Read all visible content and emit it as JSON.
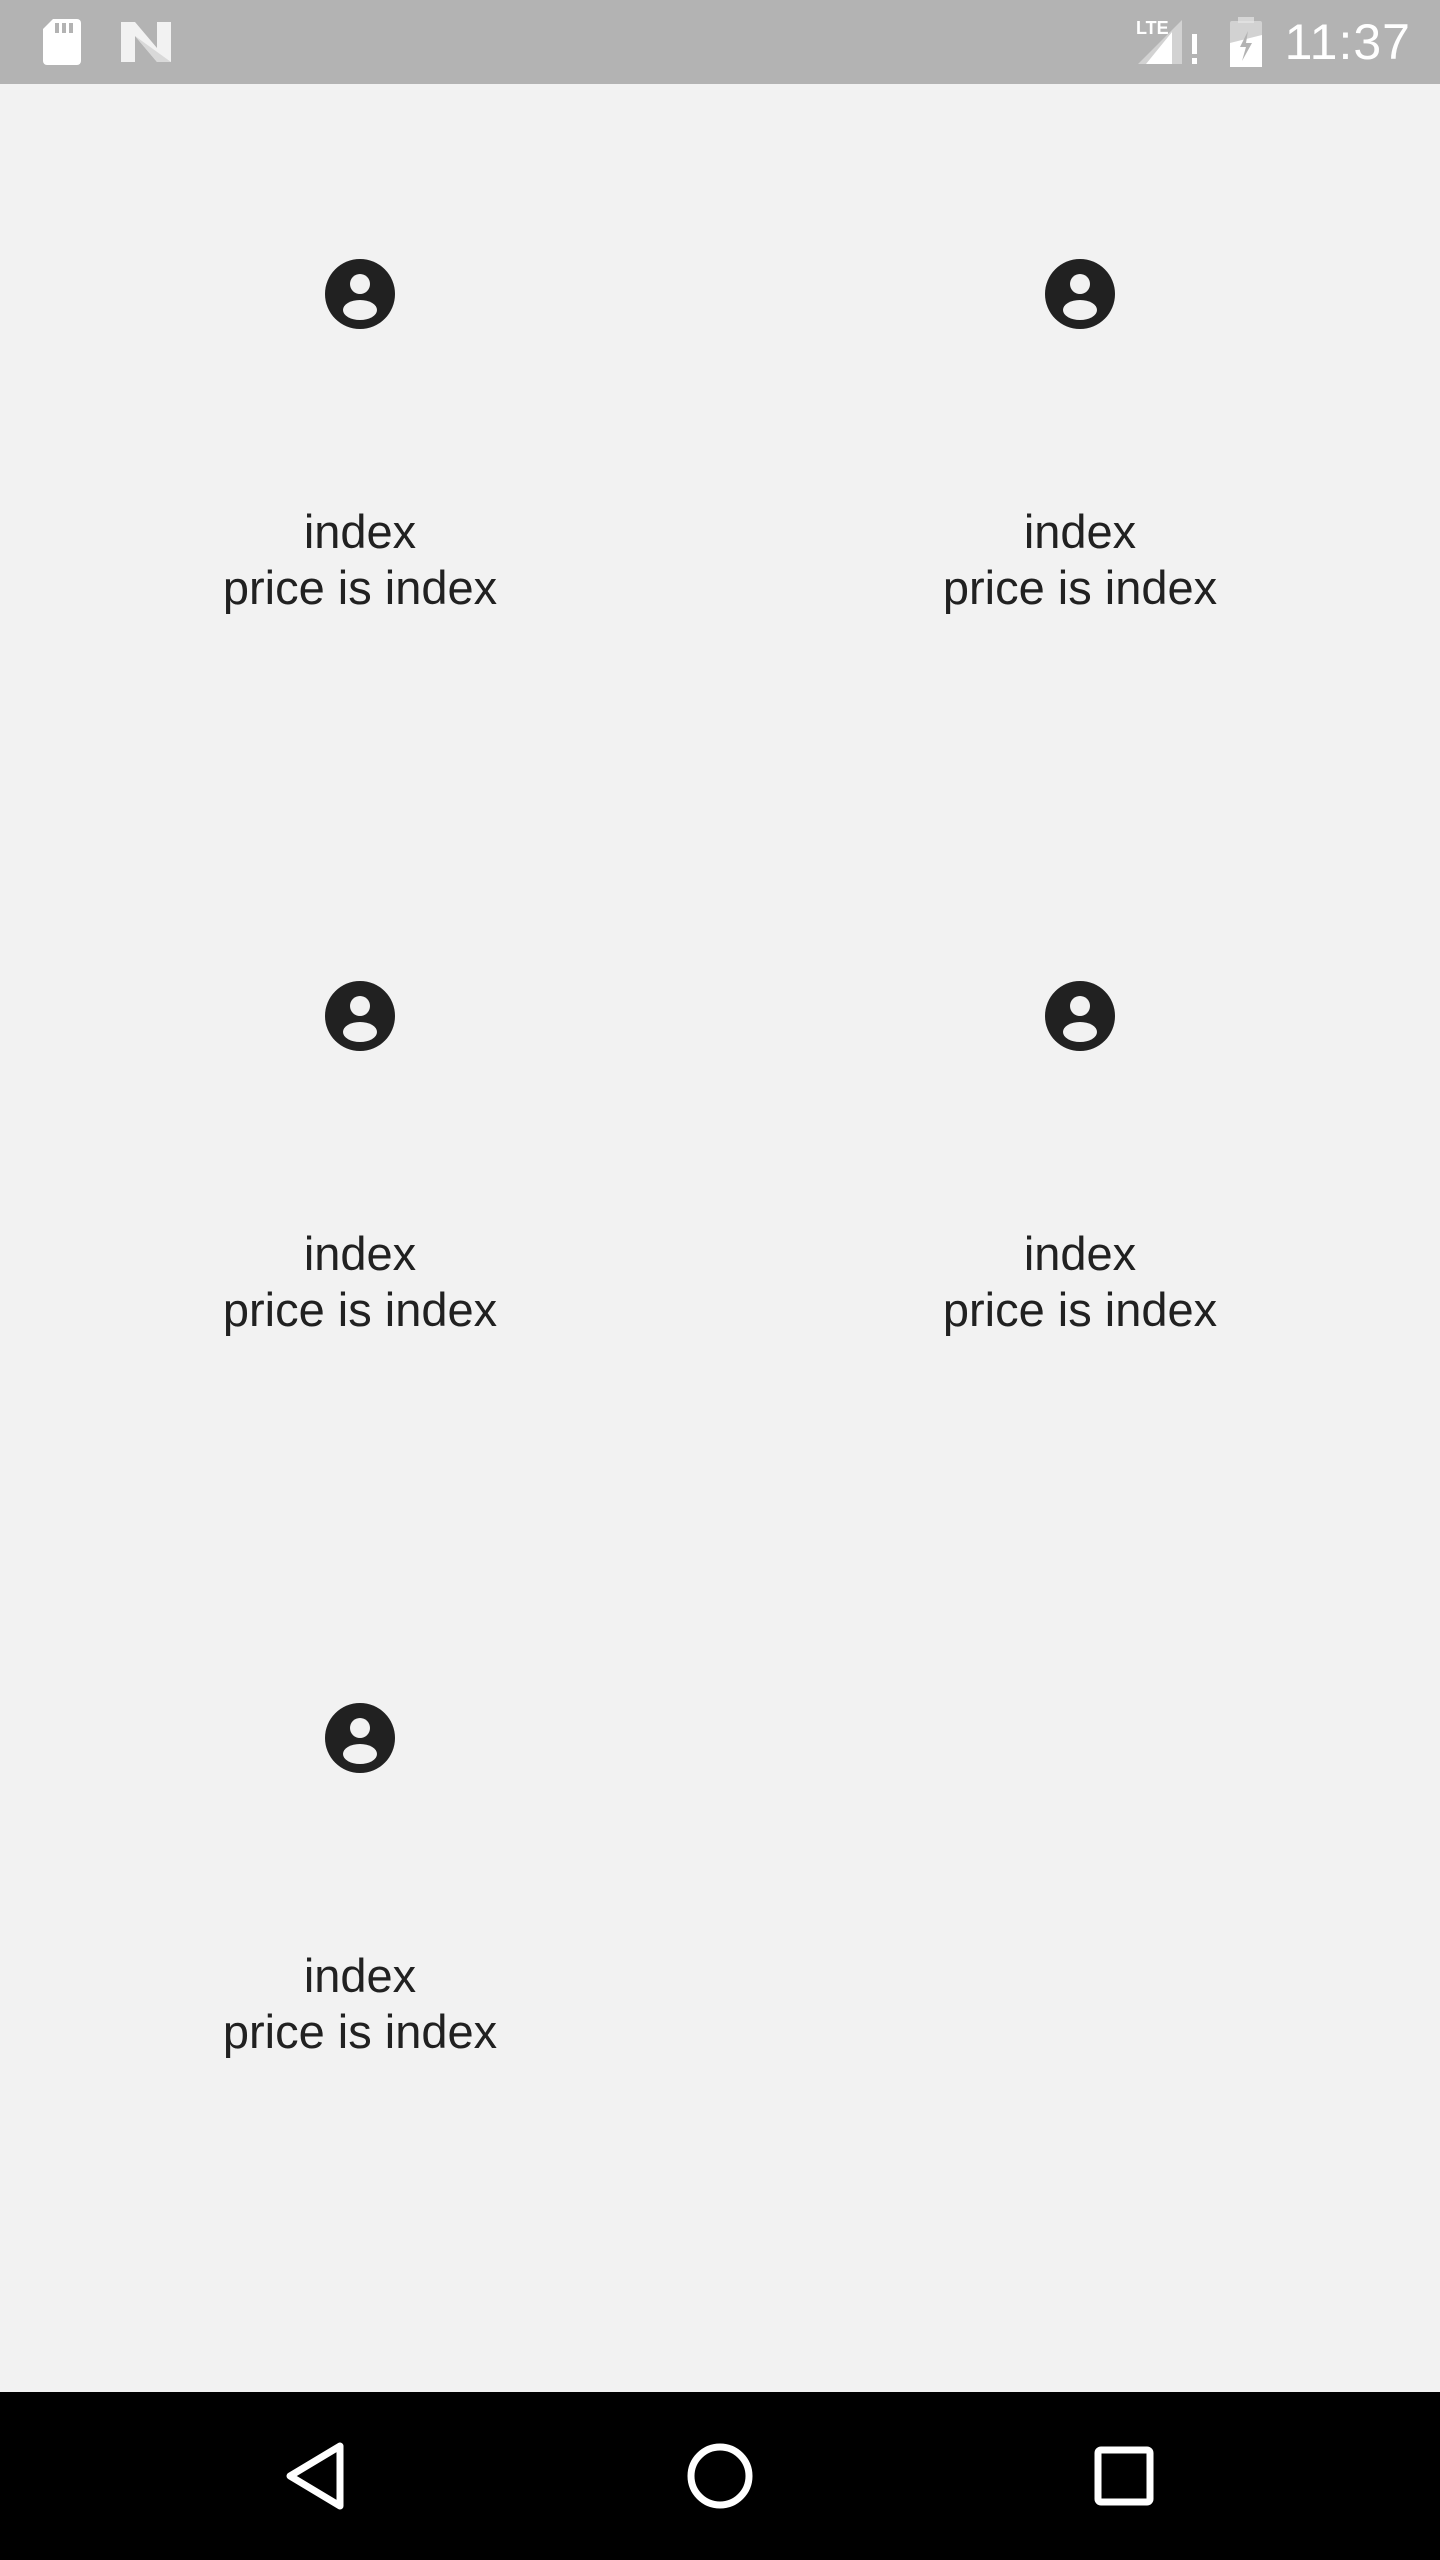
{
  "status_bar": {
    "time": "11:37",
    "network_label": "LTE",
    "left_icons": [
      "sd-card-icon",
      "n-logo-icon"
    ],
    "right_icons": [
      "signal-icon",
      "battery-icon"
    ]
  },
  "items": [
    {
      "title": "index",
      "price": "price is index",
      "icon": "account-circle-icon"
    },
    {
      "title": "index",
      "price": "price is index",
      "icon": "account-circle-icon"
    },
    {
      "title": "index",
      "price": "price is index",
      "icon": "account-circle-icon"
    },
    {
      "title": "index",
      "price": "price is index",
      "icon": "account-circle-icon"
    },
    {
      "title": "index",
      "price": "price is index",
      "icon": "account-circle-icon"
    }
  ],
  "nav_bar": {
    "buttons": [
      "back-icon",
      "home-icon",
      "recents-icon"
    ]
  },
  "colors": {
    "background": "#f2f2f2",
    "status_bar": "#b3b3b3",
    "text": "#212121",
    "nav_bar": "#000000"
  }
}
